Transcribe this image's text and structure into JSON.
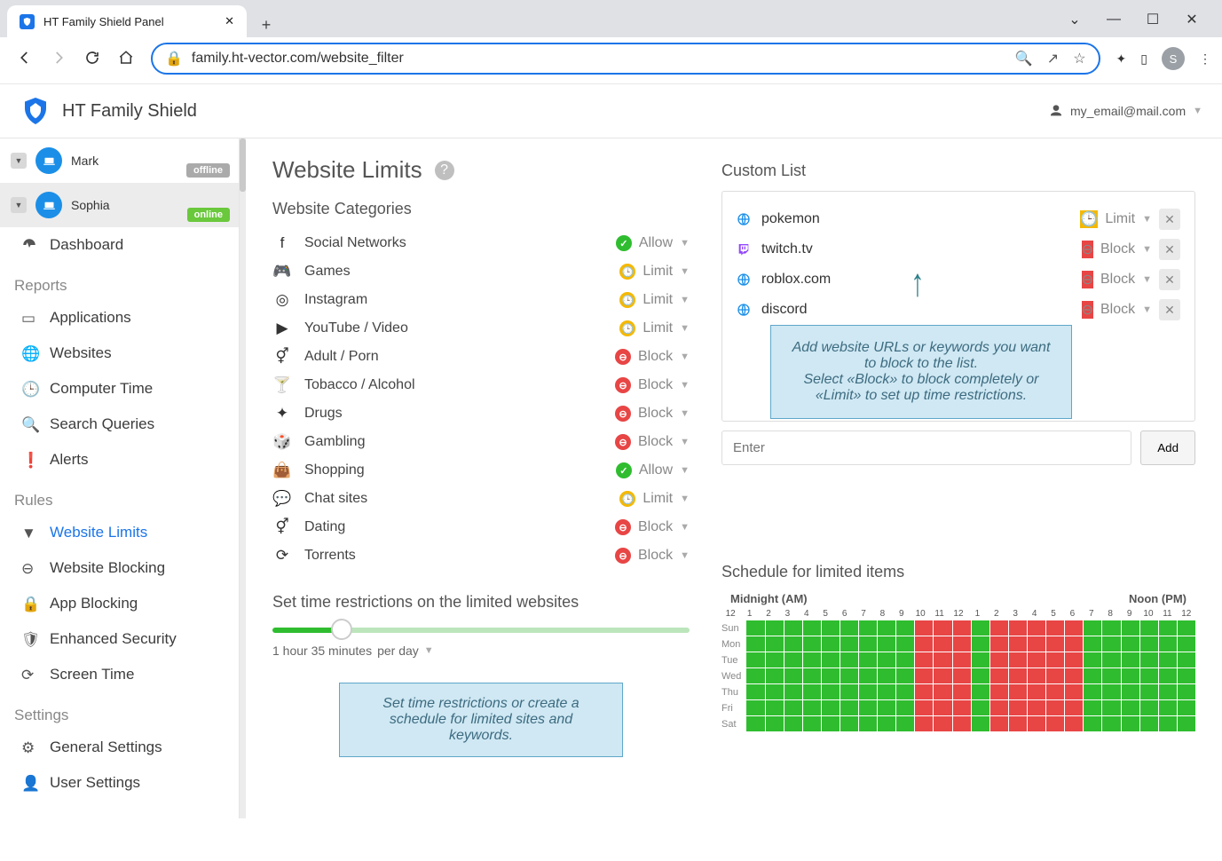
{
  "browser": {
    "tab_title": "HT Family Shield Panel",
    "url": "family.ht-vector.com/website_filter",
    "avatar_letter": "S"
  },
  "header": {
    "app_name": "HT Family Shield",
    "email": "my_email@mail.com"
  },
  "sidebar": {
    "profiles": [
      {
        "name": "Mark",
        "status": "offline"
      },
      {
        "name": "Sophia",
        "status": "online"
      }
    ],
    "dashboard": "Dashboard",
    "section_reports": "Reports",
    "reports": [
      "Applications",
      "Websites",
      "Computer Time",
      "Search Queries",
      "Alerts"
    ],
    "section_rules": "Rules",
    "rules": [
      "Website Limits",
      "Website Blocking",
      "App Blocking",
      "Enhanced Security",
      "Screen Time"
    ],
    "section_settings": "Settings",
    "settings": [
      "General Settings",
      "User Settings"
    ]
  },
  "page": {
    "title": "Website Limits",
    "categories_title": "Website Categories",
    "categories": [
      {
        "icon": "fb",
        "name": "Social Networks",
        "action": "Allow",
        "kind": "allow"
      },
      {
        "icon": "game",
        "name": "Games",
        "action": "Limit",
        "kind": "limit"
      },
      {
        "icon": "ig",
        "name": "Instagram",
        "action": "Limit",
        "kind": "limit"
      },
      {
        "icon": "yt",
        "name": "YouTube / Video",
        "action": "Limit",
        "kind": "limit"
      },
      {
        "icon": "adult",
        "name": "Adult / Porn",
        "action": "Block",
        "kind": "block"
      },
      {
        "icon": "alc",
        "name": "Tobacco / Alcohol",
        "action": "Block",
        "kind": "block"
      },
      {
        "icon": "drug",
        "name": "Drugs",
        "action": "Block",
        "kind": "block"
      },
      {
        "icon": "gamble",
        "name": "Gambling",
        "action": "Block",
        "kind": "block"
      },
      {
        "icon": "shop",
        "name": "Shopping",
        "action": "Allow",
        "kind": "allow"
      },
      {
        "icon": "chat",
        "name": "Chat sites",
        "action": "Limit",
        "kind": "limit"
      },
      {
        "icon": "date",
        "name": "Dating",
        "action": "Block",
        "kind": "block"
      },
      {
        "icon": "tor",
        "name": "Torrents",
        "action": "Block",
        "kind": "block"
      }
    ],
    "time_section": "Set time restrictions on the limited websites",
    "time_value": "1 hour 35 minutes",
    "time_unit": "per day",
    "callout_time": "Set time restrictions or create a schedule for limited sites and keywords.",
    "custom_title": "Custom List",
    "custom_list": [
      {
        "icon": "globe",
        "name": "pokemon",
        "action": "Limit",
        "kind": "limit"
      },
      {
        "icon": "twitch",
        "name": "twitch.tv",
        "action": "Block",
        "kind": "block"
      },
      {
        "icon": "globe",
        "name": "roblox.com",
        "action": "Block",
        "kind": "block"
      },
      {
        "icon": "globe",
        "name": "discord",
        "action": "Block",
        "kind": "block"
      }
    ],
    "add_placeholder": "Enter",
    "add_button": "Add",
    "callout_custom": "Add website URLs or keywords you want to block to the list.\nSelect «Block» to block completely or «Limit» to set up time restrictions.",
    "schedule_title": "Schedule for limited items",
    "midnight_label": "Midnight (AM)",
    "noon_label": "Noon (PM)",
    "days": [
      "Sun",
      "Mon",
      "Tue",
      "Wed",
      "Thu",
      "Fri",
      "Sat"
    ],
    "hours": [
      "12",
      "1",
      "2",
      "3",
      "4",
      "5",
      "6",
      "7",
      "8",
      "9",
      "10",
      "11",
      "12",
      "1",
      "2",
      "3",
      "4",
      "5",
      "6",
      "7",
      "8",
      "9",
      "10",
      "11",
      "12"
    ],
    "busy_ranges": {
      "cols_start": 9,
      "cols_end": 11,
      "cols2_start": 13,
      "cols2_end": 17
    }
  }
}
